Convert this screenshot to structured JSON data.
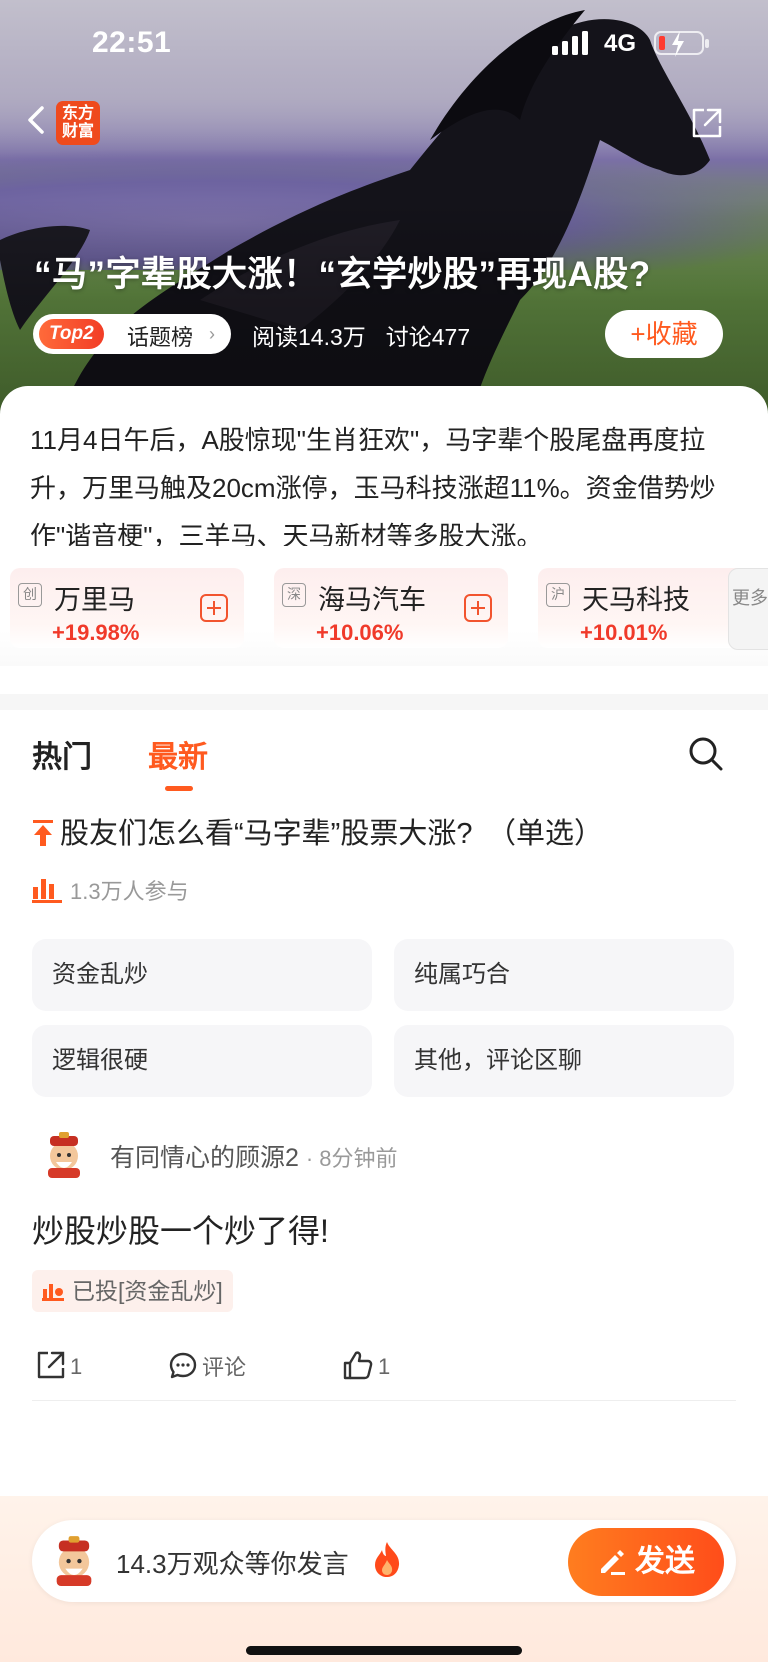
{
  "status_bar": {
    "time": "22:51",
    "network": "4G"
  },
  "header": {
    "logo_text_line1": "东方",
    "logo_text_line2": "财富",
    "title": "“马”字辈股大涨！“玄学炒股”再现A股?",
    "rank_badge": "Top2",
    "rank_label": "话题榜",
    "reads": "阅读14.3万",
    "discussions": "讨论477",
    "favorite_label": "+收藏"
  },
  "summary": "11月4日午后，A股惊现\"生肖狂欢\"，马字辈个股尾盘再度拉升，万里马触及20cm涨停，玉马科技涨超11%。资金借势炒作\"谐音梗\"，三羊马、天马新材等多股大涨。",
  "stocks": [
    {
      "market": "创",
      "name": "万里马",
      "change": "+19.98%"
    },
    {
      "market": "深",
      "name": "海马汽车",
      "change": "+10.06%"
    },
    {
      "market": "沪",
      "name": "天马科技",
      "change": "+10.01%"
    }
  ],
  "stocks_more_label": "更多",
  "tabs": {
    "hot": "热门",
    "latest": "最新",
    "active": "latest"
  },
  "poll": {
    "title": "股友们怎么看“马字辈”股票大涨?　（单选）",
    "participants": "1.3万人参与",
    "options": [
      "资金乱炒",
      "纯属巧合",
      "逻辑很硬",
      "其他，评论区聊"
    ]
  },
  "post": {
    "author": "有同情心的顾源2",
    "time": "· 8分钟前",
    "text": "炒股炒股一个炒了得!",
    "vote_tag": "已投[资金乱炒]",
    "shares": "1",
    "comment_label": "评论",
    "likes": "1"
  },
  "bottom": {
    "prompt": "14.3万观众等你发言",
    "send_label": "发送"
  },
  "colors": {
    "accent": "#ff5a1f",
    "rise": "#f03a2a"
  }
}
